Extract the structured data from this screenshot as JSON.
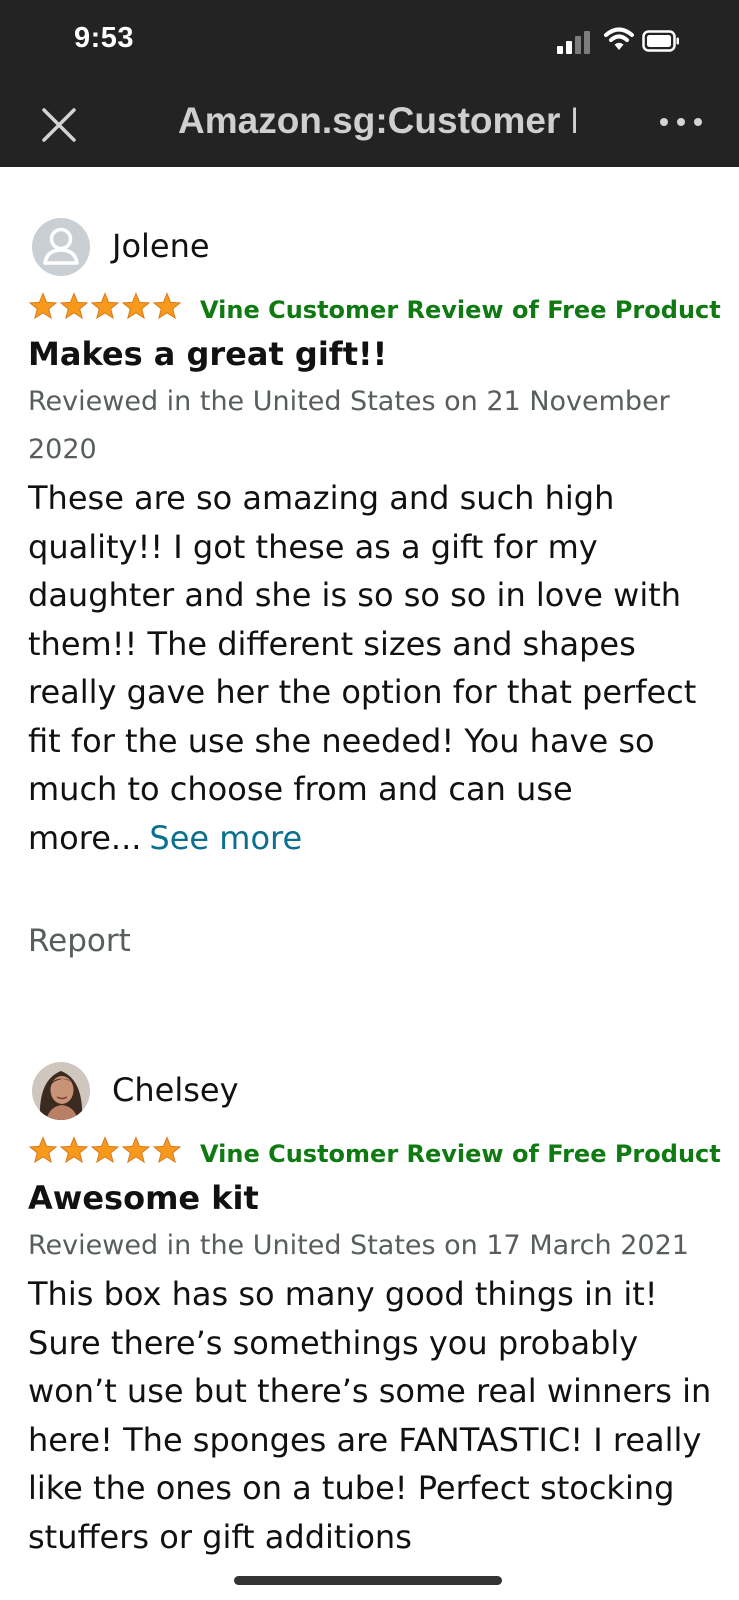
{
  "status_bar": {
    "time": "9:53"
  },
  "nav": {
    "title": "Amazon.sg:Customer Reviews"
  },
  "colors": {
    "header_bg": "#232323",
    "star": "#f79a1c",
    "vine_green": "#107a12",
    "link": "#0b6f8f",
    "muted_text": "#585d5e"
  },
  "reviews": [
    {
      "reviewer": "Jolene",
      "avatar": "default-person-icon",
      "rating": 5,
      "badge": "Vine Customer Review of Free Product",
      "title": "Makes a great gift!!",
      "date": "Reviewed in the United States on 21 November 2020",
      "body": "These are so amazing and such high quality!! I got these as a gift for my daughter and she is so so so in love with them!! The different sizes and shapes really gave her the option for that perfect fit for the use she needed! You have so much to choose from and can use more...",
      "see_more": "See more",
      "report": "Report"
    },
    {
      "reviewer": "Chelsey",
      "avatar": "user-photo",
      "rating": 5,
      "badge": "Vine Customer Review of Free Product",
      "title": "Awesome kit",
      "date": "Reviewed in the United States on 17 March 2021",
      "body": "This box has so many good things in it! Sure there’s somethings you probably won’t use but there’s some real winners in here! The sponges are FANTASTIC! I really like the ones on a tube! Perfect stocking stuffers or gift additions"
    }
  ]
}
